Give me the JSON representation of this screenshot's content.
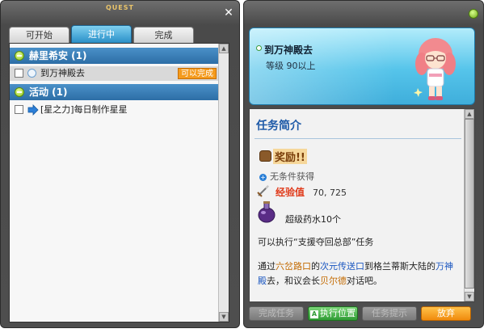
{
  "left_window": {
    "title": "QUEST",
    "tabs": [
      {
        "label": "可开始"
      },
      {
        "label": "进行中"
      },
      {
        "label": "完成"
      }
    ],
    "groups": [
      {
        "label": "赫里希安 (1)",
        "quests": [
          {
            "title": "到万神殿去",
            "badge": "可以完成"
          }
        ]
      },
      {
        "label": "活动 (1)",
        "quests": [
          {
            "title": "[星之力]每日制作星星"
          }
        ]
      }
    ]
  },
  "right_window": {
    "header": {
      "title": "到万神殿去",
      "level": "等级 90以上"
    },
    "summary_heading": "任务简介",
    "reward_heading": "奖励!!",
    "no_condition": "无条件获得",
    "exp_label": "经验值",
    "exp_value": "70, 725",
    "item_reward": "超级药水10个",
    "can_do_line": "可以执行“支援夺回总部”任务",
    "description": {
      "p1": "通过",
      "l1": "六岔路口",
      "p2": "的",
      "l2": "次元传送口",
      "p3": "到格兰蒂斯大陆的",
      "l3": "万神殿",
      "p4": "去，和议会长",
      "l4": "贝尔德",
      "p5": "对话吧。"
    },
    "buttons": {
      "complete": "完成任务",
      "execute": "执行位置",
      "hint": "任务提示",
      "abandon": "放弃"
    }
  },
  "colors": {
    "tab_active": "#2a8fc7",
    "group_header": "#2d6ea6",
    "badge_orange": "#f49a1c",
    "exp_red": "#e03a1a",
    "link_orange": "#c36a00",
    "link_blue": "#1a56c0"
  }
}
